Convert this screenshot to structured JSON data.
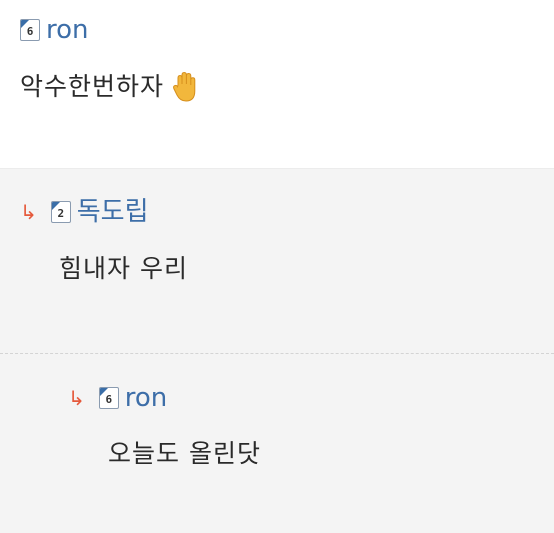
{
  "comment": {
    "level": "6",
    "author": "ron",
    "text": "악수한번하자",
    "emoji_icon": "raised-hand-icon"
  },
  "replies": [
    {
      "reply_icon": "reply-arrow-icon",
      "reply_glyph": "↳",
      "level": "2",
      "author": "독도립",
      "text": "힘내자 우리"
    },
    {
      "reply_icon": "reply-arrow-icon",
      "reply_glyph": "↳",
      "level": "6",
      "author": "ron",
      "text": "오늘도 올린닷"
    }
  ],
  "colors": {
    "author": "#3d6ea8",
    "reply_arrow": "#e5593b",
    "reply_bg": "#f4f4f4"
  }
}
